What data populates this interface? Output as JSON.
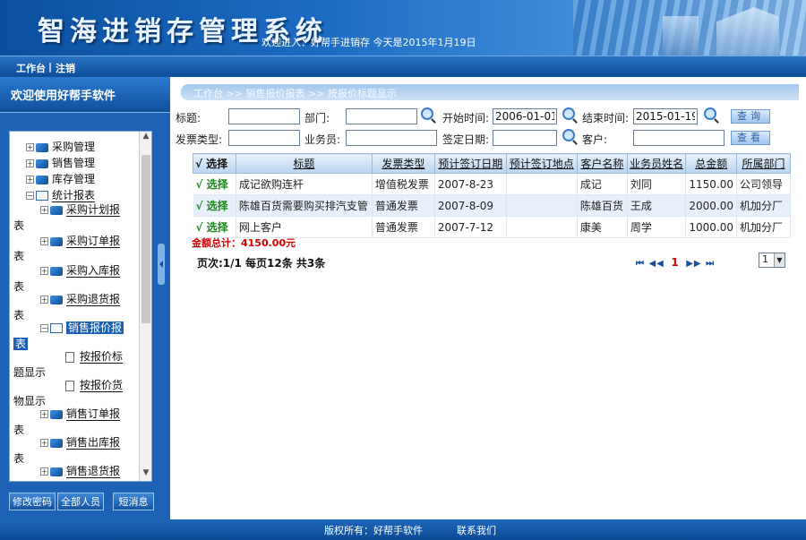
{
  "header": {
    "brand": "智海进销存管理系统",
    "welcome": "欢迎进入：好帮手进销存 今天是2015年1月19日"
  },
  "menubar": {
    "workbench": "工作台",
    "separator": "|",
    "logout": "注销"
  },
  "sidebar": {
    "title": "欢迎使用好帮手软件",
    "tree": [
      {
        "label": "采购管理"
      },
      {
        "label": "销售管理"
      },
      {
        "label": "库存管理"
      },
      {
        "label": "统计报表"
      },
      {
        "label_a": "采购计划报",
        "label_b": "表"
      },
      {
        "label_a": "采购订单报",
        "label_b": "表"
      },
      {
        "label_a": "采购入库报",
        "label_b": "表"
      },
      {
        "label_a": "采购退货报",
        "label_b": "表"
      },
      {
        "label_a": "销售报价报",
        "label_b": "表"
      },
      {
        "label_a": "按报价标",
        "label_b": "题显示"
      },
      {
        "label_a": "按报价货",
        "label_b": "物显示"
      },
      {
        "label_a": "销售订单报",
        "label_b": "表"
      },
      {
        "label_a": "销售出库报",
        "label_b": "表"
      },
      {
        "label_a": "销售退货报"
      }
    ],
    "buttons": {
      "change_password": "修改密码",
      "all_staff": "全部人员",
      "messages": "短消息"
    }
  },
  "breadcrumb": "工作台 >> 销售报价报表 >> 按报价标题显示",
  "filters": {
    "title_label": "标题:",
    "title_value": "",
    "dept_label": "部门:",
    "dept_value": "",
    "start_label": "开始时间:",
    "start_value": "2006-01-01",
    "end_label": "结束时间:",
    "end_value": "2015-01-19",
    "query_button": "查询",
    "invoice_label": "发票类型:",
    "invoice_value": "",
    "clerk_label": "业务员:",
    "clerk_value": "",
    "sign_label": "签定日期:",
    "sign_value": "",
    "customer_label": "客户:",
    "customer_value": "",
    "view_button": "查看"
  },
  "table": {
    "headers": [
      "√ 选择",
      "标题",
      "发票类型",
      "预计签订日期",
      "预计签订地点",
      "客户名称",
      "业务员姓名",
      "总金额",
      "所属部门"
    ],
    "rows": [
      [
        "√ 选择",
        "成记欲购连杆",
        "增值税发票",
        "2007-8-23",
        "",
        "成记",
        "刘同",
        "1150.00",
        "公司领导"
      ],
      [
        "√ 选择",
        "陈雄百货需要购买排汽支管",
        "普通发票",
        "2007-8-09",
        "",
        "陈雄百货",
        "王成",
        "2000.00",
        "机加分厂"
      ],
      [
        "√ 选择",
        "网上客户",
        "普通发票",
        "2007-7-12",
        "",
        "康美",
        "周学",
        "1000.00",
        "机加分厂"
      ]
    ]
  },
  "summary": {
    "total": "金额总计：4150.00元"
  },
  "pager": {
    "info": "页次:1/1 每页12条 共3条",
    "first": "⏮",
    "prev": "◀◀",
    "current": "1",
    "next": "▶▶",
    "last": "⏭",
    "page_select": "1"
  },
  "footer": {
    "copyright": "版权所有：好帮手软件",
    "contact": "联系我们"
  }
}
